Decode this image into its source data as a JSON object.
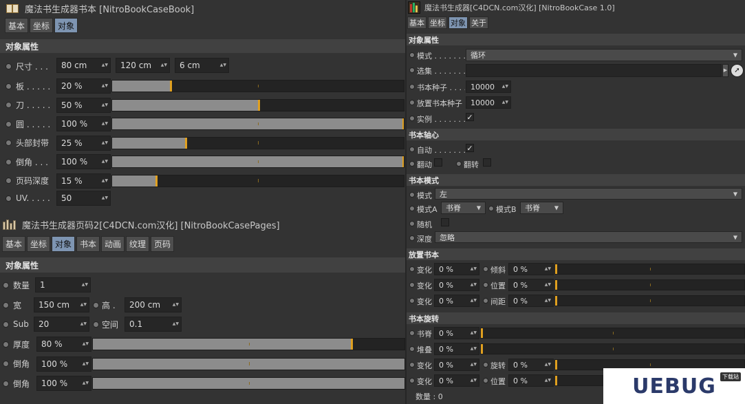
{
  "left_top": {
    "title": "魔法书生成器书本 [NitroBookCaseBook]",
    "tabs": [
      "基本",
      "坐标",
      "对象"
    ],
    "section": "对象属性",
    "size": {
      "label": "尺寸 . . .",
      "x": "80 cm",
      "y": "120 cm",
      "z": "6 cm"
    },
    "sliders": [
      {
        "label": "板 . . . . .",
        "value": "20 %",
        "pct": 20
      },
      {
        "label": "刀 . . . . .",
        "value": "50 %",
        "pct": 50
      },
      {
        "label": "圆 . . . . .",
        "value": "100 %",
        "pct": 100
      },
      {
        "label": "头部封带",
        "value": "25 %",
        "pct": 25
      },
      {
        "label": "倒角 . . .",
        "value": "100 %",
        "pct": 100
      },
      {
        "label": "页码深度",
        "value": "15 %",
        "pct": 15
      }
    ],
    "uv": {
      "label": "UV. . . . .",
      "value": "50"
    }
  },
  "left_bottom": {
    "title": "魔法书生成器页码2[C4DCN.com汉化] [NitroBookCasePages]",
    "tabs": [
      "基本",
      "坐标",
      "对象",
      "书本",
      "动画",
      "纹理",
      "页码"
    ],
    "section": "对象属性",
    "count": {
      "label": "数量",
      "value": "1"
    },
    "width": {
      "label": "宽",
      "value": "150 cm"
    },
    "height": {
      "label": "高 .",
      "value": "200 cm"
    },
    "sub": {
      "label": "Sub",
      "value": "20"
    },
    "space": {
      "label": "空间",
      "value": "0.1"
    },
    "sliders": [
      {
        "label": "厚度",
        "value": "80 %",
        "pct": 80
      },
      {
        "label": "倒角",
        "value": "100 %",
        "pct": 100
      },
      {
        "label": "倒角",
        "value": "100 %",
        "pct": 100
      }
    ]
  },
  "right": {
    "title": "魔法书生成器[C4DCN.com汉化] [NitroBookCase 1.0]",
    "tabs": [
      "基本",
      "坐标",
      "对象",
      "关于"
    ],
    "section_obj": "对象属性",
    "mode": {
      "label": "模式 . . . . . . .",
      "value": "循环"
    },
    "select": {
      "label": "选集 . . . . . . ."
    },
    "seed": {
      "label": "书本种子 . . . .",
      "value": "10000"
    },
    "place_seed": {
      "label": "放置书本种子",
      "value": "10000"
    },
    "instance": {
      "label": "实例 . . . . . . .",
      "check": "✓"
    },
    "section_axis": "书本轴心",
    "auto": {
      "label": "自动 . . . . . . .",
      "check": "✓"
    },
    "flip": {
      "label": "翻动"
    },
    "turn": {
      "label": "翻转"
    },
    "section_mode": "书本模式",
    "book_mode": {
      "label": "模式",
      "value": "左"
    },
    "mode_a": {
      "label": "模式A",
      "value": "书脊"
    },
    "mode_b": {
      "label": "模式B",
      "value": "书脊"
    },
    "random": {
      "label": "随机"
    },
    "depth": {
      "label": "深度",
      "value": "忽略"
    },
    "section_place": "放置书本",
    "place_rows": [
      {
        "l1": "变化",
        "v1": "0 %",
        "l2": "倾斜",
        "v2": "0 %"
      },
      {
        "l1": "变化",
        "v1": "0 %",
        "l2": "位置",
        "v2": "0 %"
      },
      {
        "l1": "变化",
        "v1": "0 %",
        "l2": "间距",
        "v2": "0 %"
      }
    ],
    "section_rotate": "书本旋转",
    "rot_rows": [
      {
        "l1": "书脊",
        "v1": "0 %"
      },
      {
        "l1": "堆叠",
        "v1": "0 %"
      }
    ],
    "rot_rows2": [
      {
        "l1": "变化",
        "v1": "0 %",
        "l2": "旋转",
        "v2": "0 %"
      },
      {
        "l1": "变化",
        "v1": "0 %",
        "l2": "位置",
        "v2": "0 %"
      }
    ],
    "count_label": "数量 : 0"
  },
  "watermark": {
    "text": "UEBUG",
    "tag": "下载站"
  },
  "colors": {
    "background": "#333333",
    "active_tab": "#7e95b2",
    "slider_fill": "#8c8c8c",
    "handle": "#e0a020"
  }
}
